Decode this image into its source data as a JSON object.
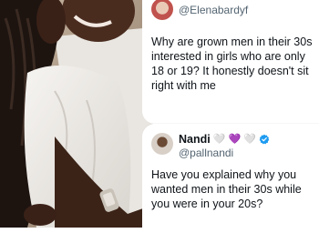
{
  "tweets": [
    {
      "display_name": "",
      "handle": "@Elenabardyf",
      "text": "Why are grown men in their 30s interested in girls who are only 18 or 19? It honestly doesn't sit right with me"
    },
    {
      "display_name": "Nandi",
      "name_emojis": [
        "🤍",
        "💜",
        "🤍"
      ],
      "verified": true,
      "handle": "@pallnandi",
      "text": "Have you explained why you wanted men in their 30s while you were in your 20s?"
    }
  ],
  "colors": {
    "text_primary": "#0f1419",
    "text_secondary": "#536471",
    "verified_badge": "#1d9bf0"
  }
}
